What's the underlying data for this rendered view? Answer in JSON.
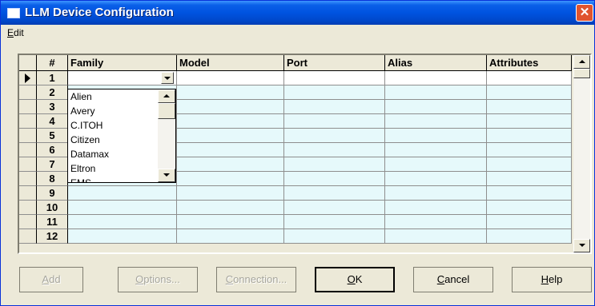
{
  "window": {
    "title": "LLM Device Configuration",
    "close_glyph": "✕"
  },
  "menu": {
    "edit": "Edit"
  },
  "grid": {
    "columns": [
      "#",
      "Family",
      "Model",
      "Port",
      "Alias",
      "Attributes"
    ],
    "rows": [
      "1",
      "2",
      "3",
      "4",
      "5",
      "6",
      "7",
      "8",
      "9",
      "10",
      "11",
      "12"
    ],
    "selected_row": "1",
    "family_dropdown": {
      "selected": "",
      "options": [
        "Alien",
        "Avery",
        "C.ITOH",
        "Citizen",
        "Datamax",
        "Eltron",
        "EMS"
      ]
    }
  },
  "buttons": {
    "add": "Add",
    "options": "Options...",
    "connection": "Connection...",
    "ok": "OK",
    "cancel": "Cancel",
    "help": "Help"
  }
}
